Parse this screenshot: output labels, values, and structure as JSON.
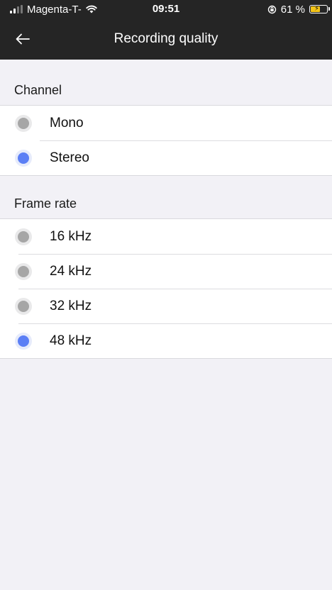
{
  "status_bar": {
    "carrier": "Magenta-T-",
    "time": "09:51",
    "battery_percent": "61 %",
    "battery_level": 0.61,
    "signal_icon": "signal-icon",
    "wifi_icon": "wifi-icon",
    "lock_icon": "rotation-lock-icon",
    "battery_color": "#f5c518"
  },
  "nav": {
    "back_icon": "arrow-left-icon",
    "title": "Recording quality"
  },
  "sections": {
    "channel": {
      "title": "Channel",
      "options": [
        {
          "label": "Mono",
          "selected": false
        },
        {
          "label": "Stereo",
          "selected": true
        }
      ]
    },
    "frame_rate": {
      "title": "Frame rate",
      "options": [
        {
          "label": "16 kHz",
          "selected": false
        },
        {
          "label": "24 kHz",
          "selected": false
        },
        {
          "label": "32 kHz",
          "selected": false
        },
        {
          "label": "48 kHz",
          "selected": true
        }
      ]
    }
  },
  "colors": {
    "header_bg": "#252525",
    "page_bg": "#f2f1f6",
    "radio_selected": "#5b7ff5",
    "radio_unselected": "#a6a6a6"
  }
}
